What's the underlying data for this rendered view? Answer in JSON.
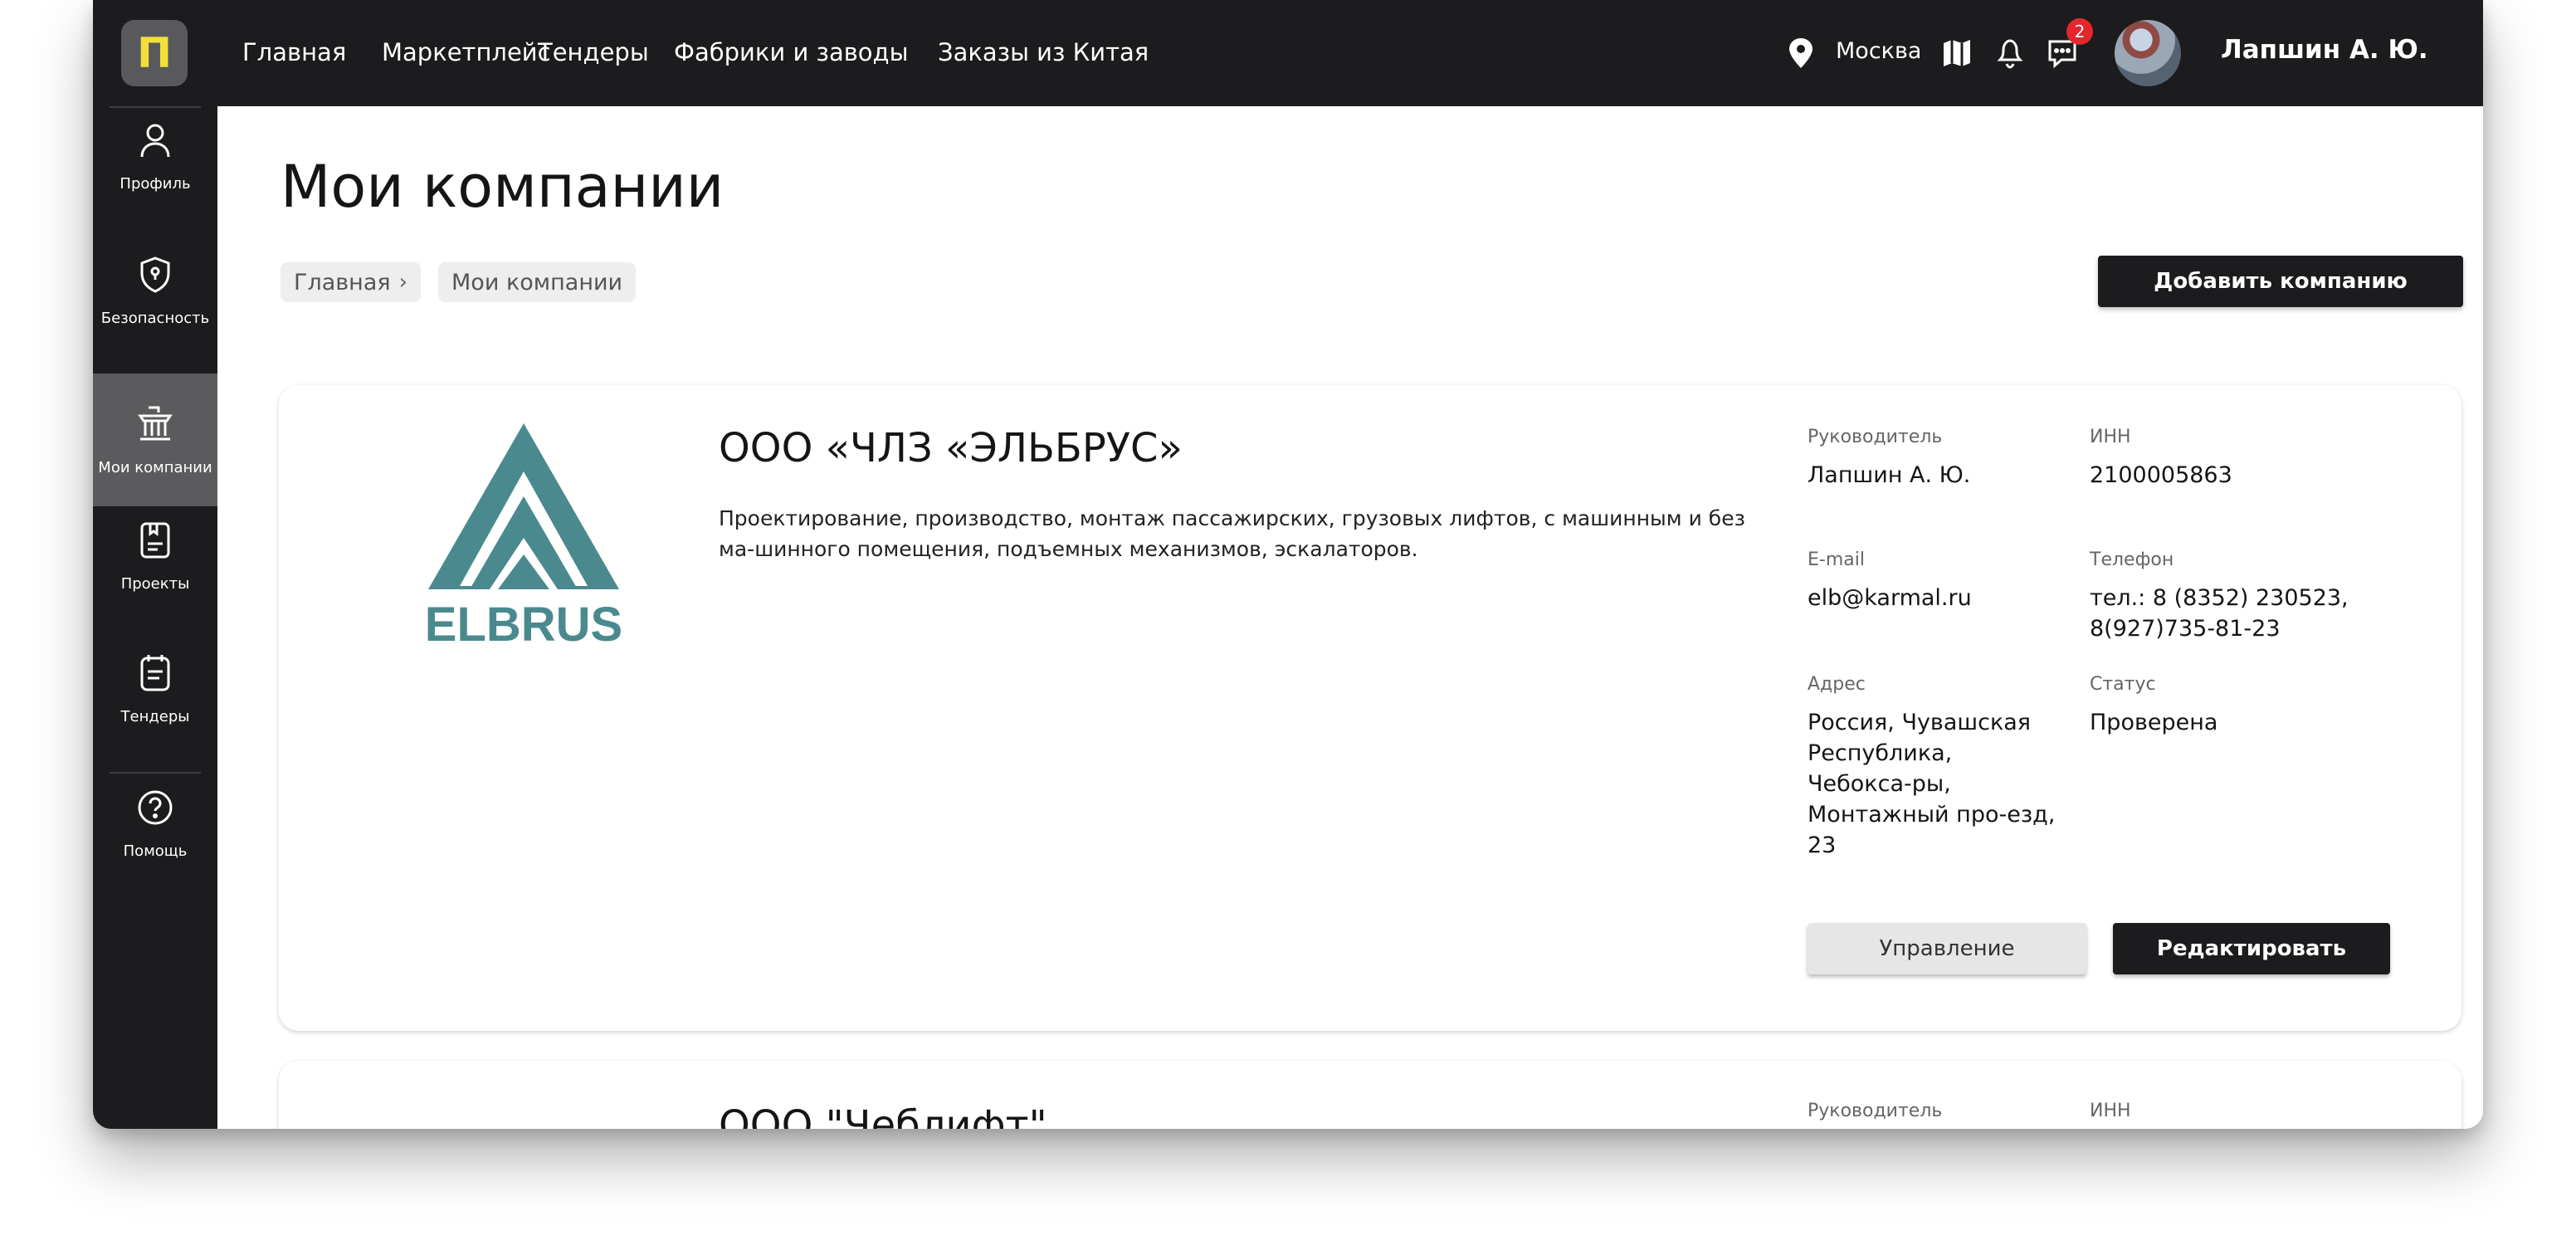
{
  "sidebar": {
    "logo_letter": "П",
    "items": [
      {
        "label": "Профиль",
        "icon": "user-icon"
      },
      {
        "label": "Безопасность",
        "icon": "shield-icon"
      },
      {
        "label": "Мои компании",
        "icon": "building-icon",
        "active": true
      },
      {
        "label": "Проекты",
        "icon": "projects-icon"
      },
      {
        "label": "Тендеры",
        "icon": "tenders-icon"
      },
      {
        "label": "Помощь",
        "icon": "help-icon"
      }
    ]
  },
  "header": {
    "nav": [
      "Главная",
      "Маркетплейс",
      "Тендеры",
      "Фабрики и заводы",
      "Заказы из Китая"
    ],
    "city": "Москва",
    "messages_badge": "2",
    "user_name": "Лапшин А. Ю."
  },
  "page": {
    "title": "Мои компании",
    "breadcrumb": [
      "Главная",
      "Мои компании"
    ],
    "add_button": "Добавить компанию"
  },
  "companies": [
    {
      "name": "ООО «ЧЛЗ «ЭЛЬБРУС»",
      "logo_text": "ELBRUS",
      "description": "Проектирование, производство, монтаж пассажирских, грузовых лифтов, с машинным и без ма-шинного помещения, подъемных механизмов, эскалаторов.",
      "fields": {
        "manager_label": "Руководитель",
        "manager": "Лапшин А. Ю.",
        "inn_label": "ИНН",
        "inn": "2100005863",
        "email_label": "E-mail",
        "email": "elb@karmal.ru",
        "phone_label": "Телефон",
        "phone": "тел.: 8 (8352) 230523, 8(927)735-81-23",
        "address_label": "Адрес",
        "address": "Россия, Чувашская Республика, Чебокса-ры, Монтажный про-езд, 23",
        "status_label": "Статус",
        "status": "Проверена"
      },
      "manage_button": "Управление",
      "edit_button": "Редактировать"
    },
    {
      "name": "ООО \"Чеблифт\"",
      "fields": {
        "manager_label": "Руководитель",
        "inn_label": "ИНН"
      }
    }
  ],
  "colors": {
    "dark": "#1c1c1e",
    "logo_yellow": "#f2df3d",
    "elbrus_teal": "#4a8a8e",
    "badge_red": "#e5262d",
    "active_item": "#5b5b5e"
  }
}
